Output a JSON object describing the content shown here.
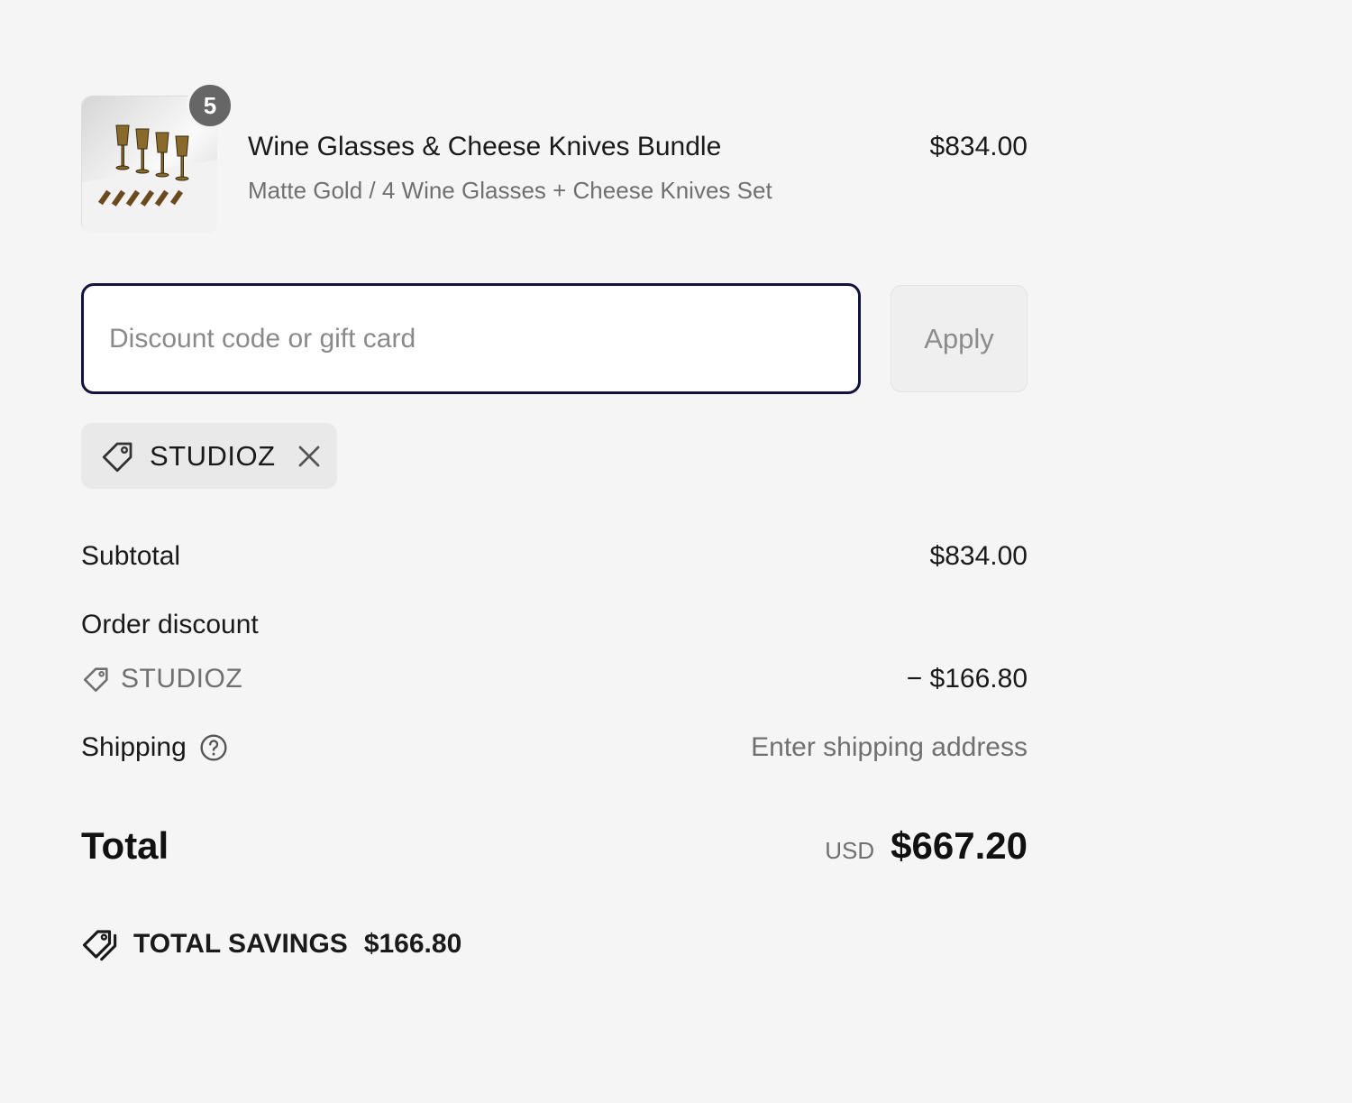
{
  "line_item": {
    "quantity": "5",
    "title": "Wine Glasses & Cheese Knives Bundle",
    "variant": "Matte Gold / 4 Wine Glasses + Cheese Knives Set",
    "price": "$834.00",
    "image_icon": "product-thumbnail"
  },
  "discount": {
    "placeholder": "Discount code or gift card",
    "value": "",
    "apply_label": "Apply",
    "applied_code": "STUDIOZ"
  },
  "totals": {
    "subtotal_label": "Subtotal",
    "subtotal_value": "$834.00",
    "order_discount_label": "Order discount",
    "discount_code": "STUDIOZ",
    "discount_value": "− $166.80",
    "shipping_label": "Shipping",
    "shipping_value": "Enter shipping address",
    "total_label": "Total",
    "currency": "USD",
    "total_value": "$667.20",
    "savings_label": "TOTAL SAVINGS",
    "savings_value": "$166.80"
  },
  "colors": {
    "background": "#f5f5f5",
    "input_border": "#12123f",
    "badge": "#666666",
    "muted_text": "#707070"
  },
  "icons": [
    "tag-icon",
    "close-icon",
    "help-circle-icon",
    "double-tag-icon"
  ]
}
